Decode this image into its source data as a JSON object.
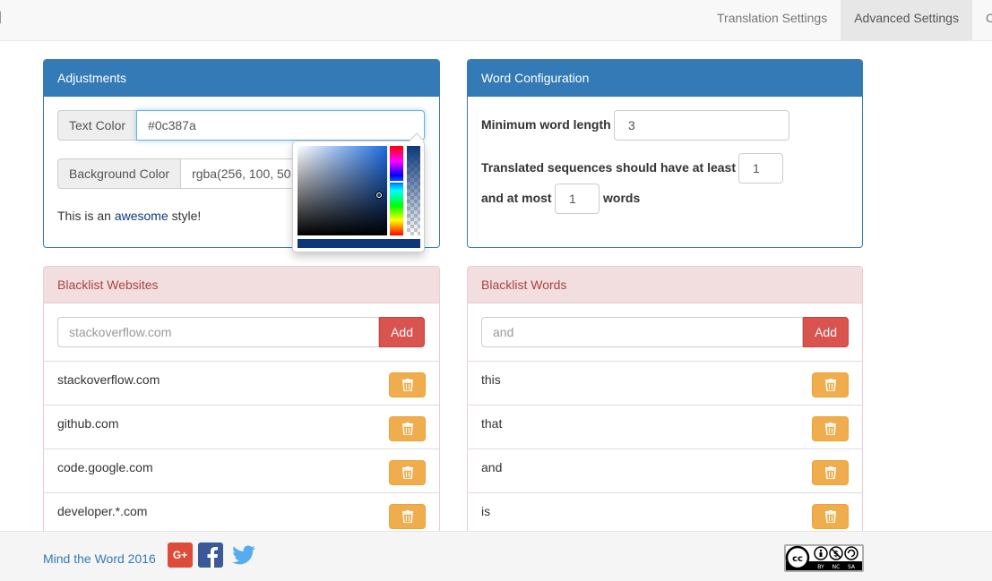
{
  "navbar": {
    "brand": "d",
    "tabs": [
      {
        "label": "Translation Settings",
        "active": false
      },
      {
        "label": "Advanced Settings",
        "active": true
      },
      {
        "label": "C",
        "active": false
      }
    ]
  },
  "adjustments": {
    "title": "Adjustments",
    "text_color_label": "Text Color",
    "text_color_value": "#0c387a",
    "background_color_label": "Background Color",
    "background_color_value": "rgba(256, 100, 50",
    "sample_prefix": "This is an ",
    "sample_highlight": "awesome",
    "sample_suffix": " style!",
    "picker_color": "#0c387a"
  },
  "word_config": {
    "title": "Word Configuration",
    "min_length_label": "Minimum word length",
    "min_length_value": "3",
    "sequence_label_1": "Translated sequences should have at least",
    "sequence_min_value": "1",
    "sequence_label_2": "and at most",
    "sequence_max_value": "1",
    "sequence_label_3": "words"
  },
  "blacklist_websites": {
    "title": "Blacklist Websites",
    "input_placeholder": "stackoverflow.com",
    "add_label": "Add",
    "items": [
      "stackoverflow.com",
      "github.com",
      "code.google.com",
      "developer.*.com"
    ]
  },
  "blacklist_words": {
    "title": "Blacklist Words",
    "input_placeholder": "and",
    "add_label": "Add",
    "items": [
      "this",
      "that",
      "and",
      "is"
    ]
  },
  "footer": {
    "link_text": "Mind the Word 2016",
    "gplus_label": "G+",
    "social_icons": [
      "google-plus-icon",
      "facebook-icon",
      "twitter-icon"
    ],
    "license": "CC BY NC SA"
  },
  "colors": {
    "primary": "#337ab7",
    "danger": "#d9534f",
    "warning": "#f0ad4e"
  }
}
